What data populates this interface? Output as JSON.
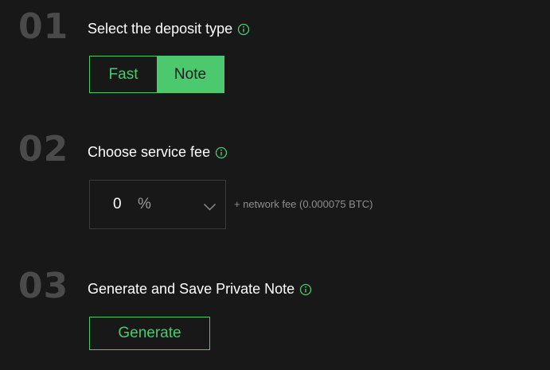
{
  "steps": [
    {
      "number": "01",
      "title": "Select the deposit type"
    },
    {
      "number": "02",
      "title": "Choose service fee"
    },
    {
      "number": "03",
      "title": "Generate and Save Private Note"
    }
  ],
  "deposit_type": {
    "options": [
      "Fast",
      "Note"
    ],
    "selected": "Note"
  },
  "service_fee": {
    "value": "0",
    "unit": "%",
    "network_fee_note": "+ network fee (0.000075 BTC)"
  },
  "generate": {
    "label": "Generate"
  },
  "icons": {
    "info": "info-circle-icon",
    "dropdown": "chevron-down-icon"
  },
  "colors": {
    "accent": "#4cc86e",
    "background": "#181818",
    "step_number": "#4a4a4a"
  }
}
